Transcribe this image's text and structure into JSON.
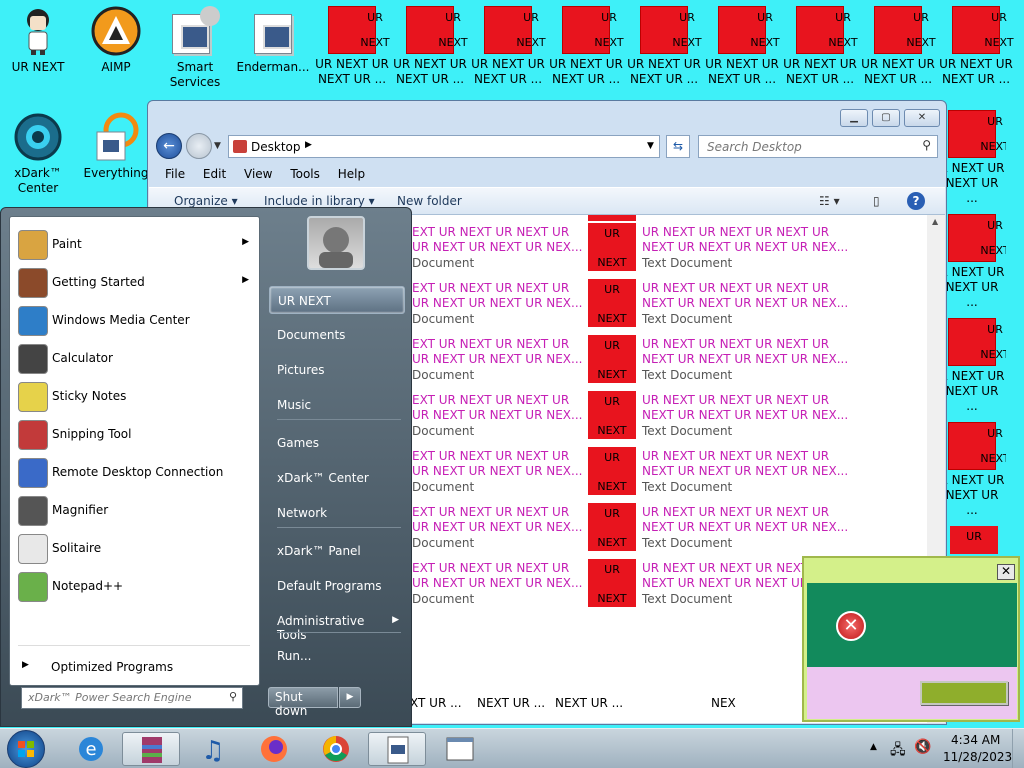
{
  "desktop": {
    "top_icons": [
      {
        "label": "UR NEXT",
        "icon": "person-icon"
      },
      {
        "label": "AIMP",
        "icon": "aimp-icon"
      },
      {
        "label": "Smart\nServices",
        "icon": "smart-services-icon"
      },
      {
        "label": "Enderman...",
        "icon": "enderman-icon"
      }
    ],
    "ur_icon_top": "UR",
    "ur_icon_bottom": "NEXT",
    "ur_label_line1": "UR NEXT UR",
    "ur_label_line2": "NEXT UR ...",
    "right_label_line1": "R NEXT UR",
    "right_label_line2": "NEXT UR ...",
    "left_icons": [
      {
        "label": "xDark™\nCenter",
        "icon": "xdark-center-icon"
      },
      {
        "label": "Everything",
        "icon": "everything-icon"
      }
    ],
    "bottom_labels": [
      "XT UR ...",
      "NEXT UR ...",
      "NEXT UR ...",
      "NEX"
    ]
  },
  "explorer": {
    "address": "Desktop",
    "search_placeholder": "Search Desktop",
    "menu": [
      "File",
      "Edit",
      "View",
      "Tools",
      "Help"
    ],
    "toolbar": {
      "organize": "Organize",
      "include": "Include in library",
      "new_folder": "New folder"
    },
    "rows": {
      "left_line1": "EXT UR NEXT UR NEXT UR",
      "left_line2": "UR NEXT UR NEXT UR NEX...",
      "left_type": "Document",
      "icon_top": "UR",
      "icon_bottom": "NEXT",
      "right_line1": "UR NEXT UR NEXT UR NEXT UR",
      "right_line2": "NEXT UR NEXT UR NEXT UR NEX...",
      "right_type": "Text Document",
      "count": 7
    }
  },
  "start_menu": {
    "programs": [
      {
        "label": "Paint",
        "icon": "paint-icon",
        "submenu": true
      },
      {
        "label": "Getting Started",
        "icon": "getting-started-icon",
        "submenu": true
      },
      {
        "label": "Windows Media Center",
        "icon": "media-center-icon",
        "submenu": false
      },
      {
        "label": "Calculator",
        "icon": "calculator-icon",
        "submenu": false
      },
      {
        "label": "Sticky Notes",
        "icon": "sticky-notes-icon",
        "submenu": false
      },
      {
        "label": "Snipping Tool",
        "icon": "snipping-tool-icon",
        "submenu": false
      },
      {
        "label": "Remote Desktop Connection",
        "icon": "remote-desktop-icon",
        "submenu": false
      },
      {
        "label": "Magnifier",
        "icon": "magnifier-icon",
        "submenu": false
      },
      {
        "label": "Solitaire",
        "icon": "solitaire-icon",
        "submenu": false
      },
      {
        "label": "Notepad++",
        "icon": "notepadpp-icon",
        "submenu": false
      }
    ],
    "all_programs": "Optimized Programs",
    "search_placeholder": "xDark™ Power Search Engine",
    "right_items": [
      "UR NEXT",
      "Documents",
      "Pictures",
      "Music",
      "Games",
      "xDark™ Center",
      "Network",
      "xDark™ Panel",
      "Default Programs",
      "Administrative Tools",
      "Run..."
    ],
    "shutdown": "Shut down"
  },
  "taskbar": {
    "time": "4:34 AM",
    "date": "11/28/2023",
    "apps": [
      "start-orb-icon",
      "internet-explorer-icon",
      "winrar-icon",
      "music-icon",
      "firefox-icon",
      "chrome-icon",
      "document-icon",
      "window-icon"
    ]
  },
  "colors": {
    "desktop": "#3ef0f8",
    "ur_red": "#e8141e",
    "link_pink": "#c51fb5",
    "dialog_green": "#128a5c",
    "dialog_pink": "#ecc6f0",
    "dialog_button": "#8fae2c"
  }
}
